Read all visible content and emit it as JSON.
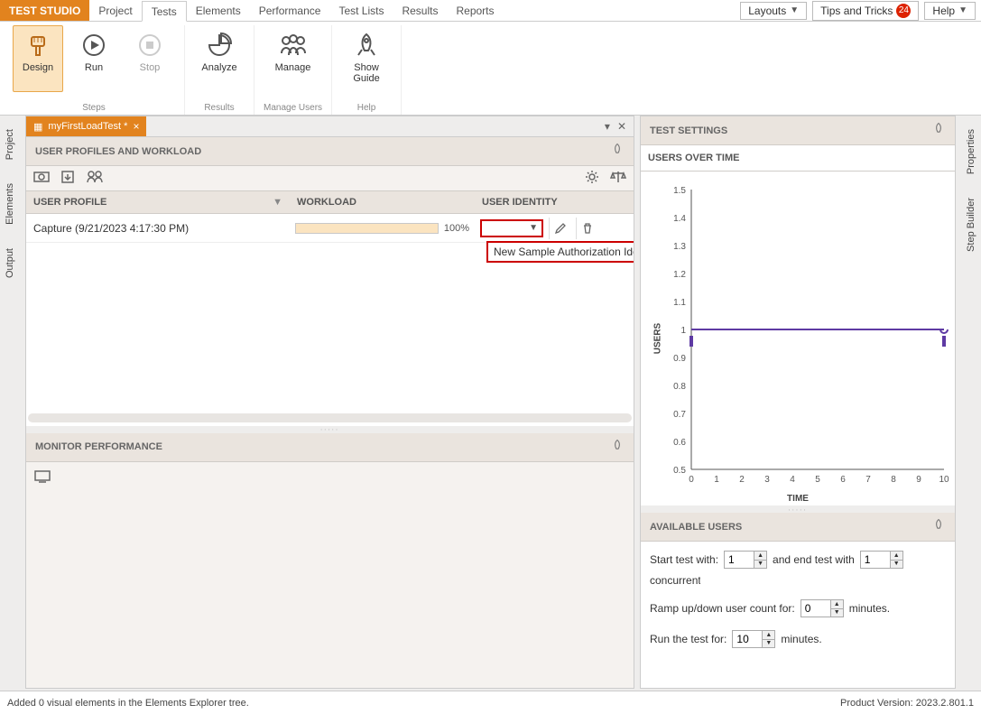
{
  "brand": "TEST STUDIO",
  "menu": {
    "items": [
      "Project",
      "Tests",
      "Elements",
      "Performance",
      "Test Lists",
      "Results",
      "Reports"
    ],
    "active_index": 1,
    "layouts_label": "Layouts",
    "tips_label": "Tips and Tricks",
    "tips_badge": "24",
    "help_label": "Help"
  },
  "ribbon": {
    "groups": [
      {
        "label": "Steps",
        "buttons": [
          {
            "label": "Design",
            "icon": "brush-icon",
            "active": true
          },
          {
            "label": "Run",
            "icon": "play-icon"
          },
          {
            "label": "Stop",
            "icon": "stop-icon",
            "disabled": true
          }
        ]
      },
      {
        "label": "Results",
        "buttons": [
          {
            "label": "Analyze",
            "icon": "pie-icon"
          }
        ]
      },
      {
        "label": "Manage Users",
        "buttons": [
          {
            "label": "Manage",
            "icon": "people-icon"
          }
        ]
      },
      {
        "label": "Help",
        "buttons": [
          {
            "label": "Show Guide",
            "icon": "rocket-icon"
          }
        ]
      }
    ]
  },
  "left_side_tabs": [
    "Project",
    "Elements",
    "Output"
  ],
  "right_side_tabs": [
    "Properties",
    "Step Builder"
  ],
  "doc_tab": {
    "title": "myFirstLoadTest *"
  },
  "panels": {
    "user_profiles_header": "USER PROFILES AND WORKLOAD",
    "monitor_header": "MONITOR PERFORMANCE",
    "test_settings_header": "TEST SETTINGS",
    "users_over_time_header": "USERS OVER TIME",
    "available_users_header": "AVAILABLE USERS"
  },
  "grid": {
    "columns": {
      "profile": "USER PROFILE",
      "workload": "WORKLOAD",
      "identity": "USER IDENTITY"
    },
    "rows": [
      {
        "profile": "Capture (9/21/2023 4:17:30 PM)",
        "workload_pct": "100%",
        "identity_selected": ""
      }
    ],
    "identity_dropdown_item": "New Sample Authorization Identity"
  },
  "chart_data": {
    "type": "line",
    "title": "",
    "xlabel": "TIME",
    "ylabel": "USERS",
    "x": [
      0,
      1,
      2,
      3,
      4,
      5,
      6,
      7,
      8,
      9,
      10
    ],
    "series": [
      {
        "name": "users",
        "values": [
          1,
          1,
          1,
          1,
          1,
          1,
          1,
          1,
          1,
          1,
          1
        ],
        "color": "#5e3aa3"
      }
    ],
    "xlim": [
      0,
      10
    ],
    "ylim": [
      0.5,
      1.5
    ],
    "yticks": [
      0.5,
      0.6,
      0.7,
      0.8,
      0.9,
      1.0,
      1.1,
      1.2,
      1.3,
      1.4,
      1.5
    ],
    "xticks": [
      0,
      1,
      2,
      3,
      4,
      5,
      6,
      7,
      8,
      9,
      10
    ]
  },
  "available_users": {
    "start_label_a": "Start test with:",
    "start_value": "1",
    "start_label_b": "and end test with",
    "end_value": "1",
    "start_label_c": "concurrent users.",
    "ramp_label_a": "Ramp up/down user count for:",
    "ramp_value": "0",
    "ramp_label_b": "minutes.",
    "run_label_a": "Run the test for:",
    "run_value": "10",
    "run_label_b": "minutes."
  },
  "statusbar": {
    "left": "Added 0 visual elements in the Elements Explorer tree.",
    "right": "Product Version: 2023.2.801.1"
  }
}
